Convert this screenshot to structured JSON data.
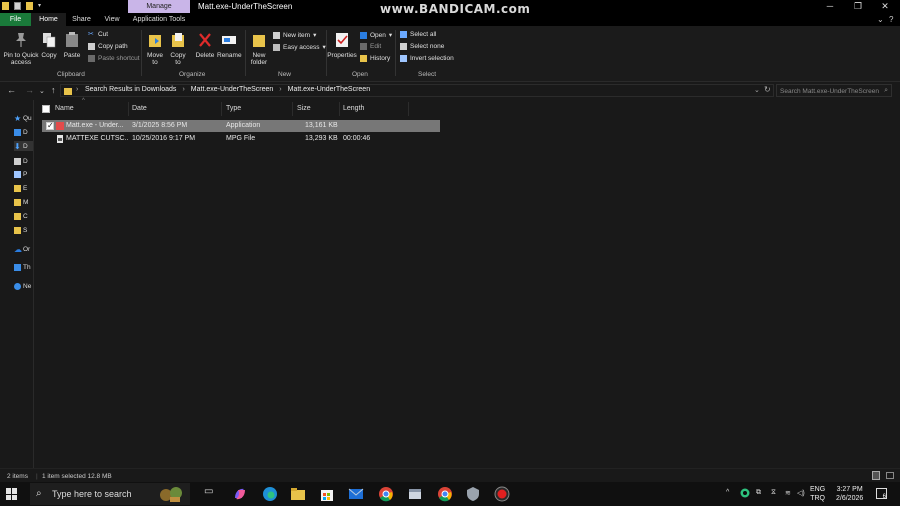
{
  "titlebar": {
    "manage_tab": "Manage",
    "window_title": "Matt.exe-UnderTheScreen",
    "watermark": "www.BANDICAM.com"
  },
  "ribbon_tabs": [
    "File",
    "Home",
    "Share",
    "View",
    "Application Tools"
  ],
  "ribbon": {
    "clipboard": {
      "pin_label": "Pin to Quick access",
      "copy_label": "Copy",
      "paste_label": "Paste",
      "cut_label": "Cut",
      "copy_path_label": "Copy path",
      "paste_shortcut_label": "Paste shortcut",
      "group_label": "Clipboard"
    },
    "organize": {
      "move_to_label": "Move to",
      "copy_to_label": "Copy to",
      "delete_label": "Delete",
      "rename_label": "Rename",
      "group_label": "Organize"
    },
    "new": {
      "new_folder_label": "New folder",
      "new_item_label": "New item",
      "easy_access_label": "Easy access",
      "group_label": "New"
    },
    "open": {
      "properties_label": "Properties",
      "open_label": "Open",
      "edit_label": "Edit",
      "history_label": "History",
      "group_label": "Open"
    },
    "select": {
      "select_all_label": "Select all",
      "select_none_label": "Select none",
      "invert_selection_label": "Invert selection",
      "group_label": "Select"
    }
  },
  "address": {
    "crumbs": [
      "Search Results in Downloads",
      "Matt.exe-UnderTheScreen",
      "Matt.exe-UnderTheScreen"
    ],
    "search_placeholder": "Search Matt.exe-UnderTheScreen"
  },
  "sidebar": {
    "items": [
      {
        "label": "Qu",
        "icon": "star-icon"
      },
      {
        "label": "D",
        "icon": "desktop-icon"
      },
      {
        "label": "D",
        "icon": "downloads-icon"
      },
      {
        "label": "D",
        "icon": "documents-icon"
      },
      {
        "label": "P",
        "icon": "pictures-icon"
      },
      {
        "label": "E",
        "icon": "folder-icon"
      },
      {
        "label": "M",
        "icon": "folder-icon"
      },
      {
        "label": "C",
        "icon": "folder-icon"
      },
      {
        "label": "S",
        "icon": "folder-icon"
      },
      {
        "label": "Or",
        "icon": "onedrive-icon"
      },
      {
        "label": "Th",
        "icon": "this-pc-icon"
      },
      {
        "label": "Ne",
        "icon": "network-icon"
      }
    ]
  },
  "columns": [
    "Name",
    "Date",
    "Type",
    "Size",
    "Length"
  ],
  "files": [
    {
      "name": "Matt.exe - Under...",
      "date": "3/1/2025 8:56 PM",
      "type": "Application",
      "size": "13,161 KB",
      "length": ""
    },
    {
      "name": "MATTEXE CUTSC...",
      "date": "10/25/2016 9:17 PM",
      "type": "MPG File",
      "size": "13,293 KB",
      "length": "00:00:46"
    }
  ],
  "status": {
    "items_count": "2 items",
    "selected": "1 item selected  12.8 MB"
  },
  "taskbar": {
    "search_placeholder": "Type here to search",
    "lang_top": "ENG",
    "lang_bottom": "TRQ",
    "time": "3:27 PM",
    "date": "2/6/2026",
    "notification_count": "6"
  },
  "colors": {
    "file_tab": "#1a7a3a",
    "manage_tab": "#c9b5e8",
    "selected_row": "#777777",
    "background": "#191919"
  }
}
